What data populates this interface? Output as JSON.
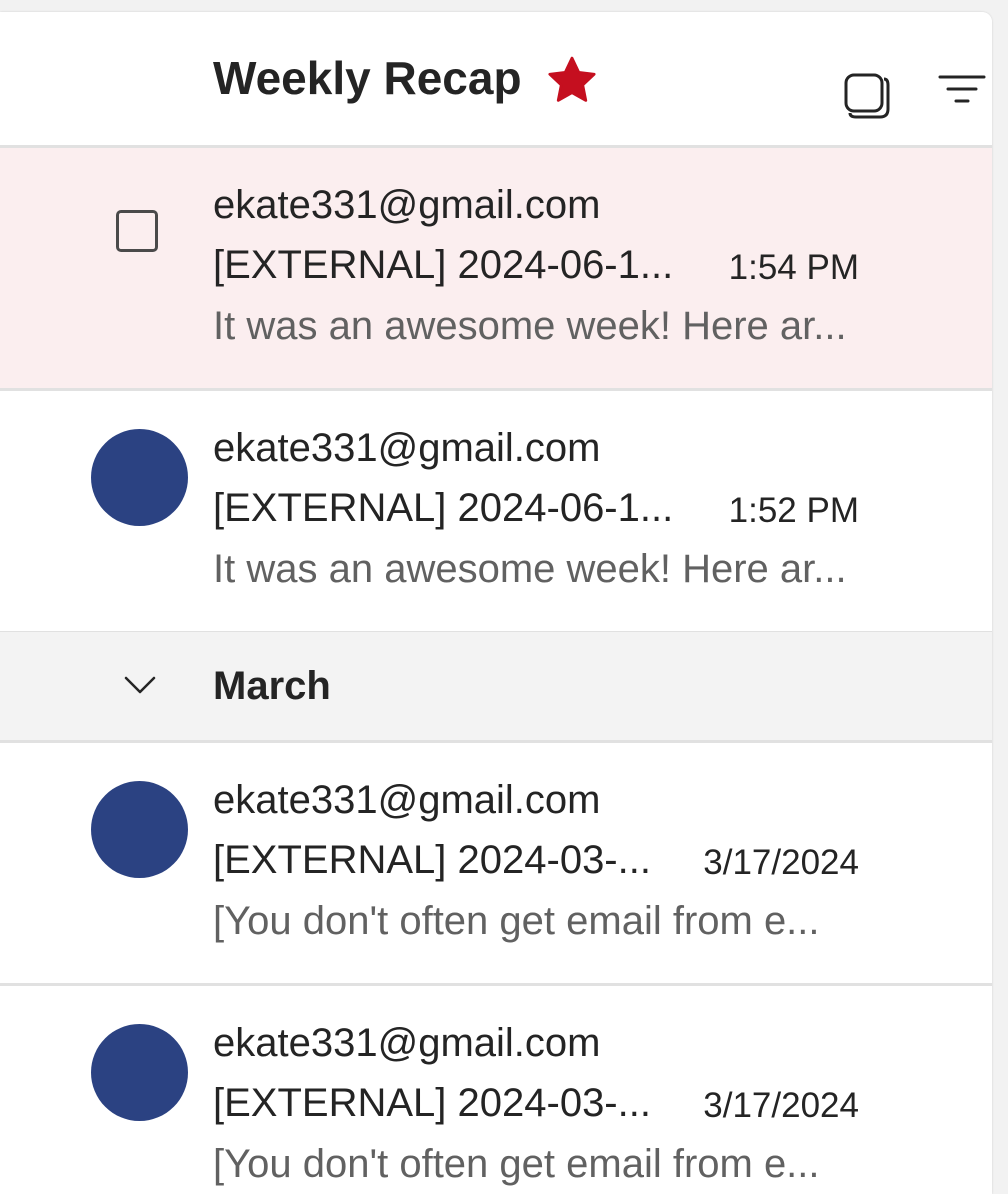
{
  "header": {
    "title": "Weekly Recap",
    "favorite_icon": "star-filled-icon",
    "favorite_color": "#c50f1f",
    "select_icon": "select-multiple-icon",
    "filter_icon": "filter-icon"
  },
  "groups": [
    {
      "label": "March",
      "collapse_icon": "chevron-down-icon"
    }
  ],
  "avatar_color": "#2b4282",
  "messages": [
    {
      "sender": "ekate331@gmail.com",
      "subject": "[EXTERNAL] 2024-06-1...",
      "time": "1:54 PM",
      "preview": "It was an awesome week! Here ar...",
      "selected": true
    },
    {
      "sender": "ekate331@gmail.com",
      "subject": "[EXTERNAL] 2024-06-1...",
      "time": "1:52 PM",
      "preview": "It was an awesome week! Here ar...",
      "selected": false
    },
    {
      "sender": "ekate331@gmail.com",
      "subject": "[EXTERNAL] 2024-03-...",
      "time": "3/17/2024",
      "preview": "[You don't often get email from e...",
      "selected": false
    },
    {
      "sender": "ekate331@gmail.com",
      "subject": "[EXTERNAL] 2024-03-...",
      "time": "3/17/2024",
      "preview": "[You don't often get email from e...",
      "selected": false
    }
  ]
}
